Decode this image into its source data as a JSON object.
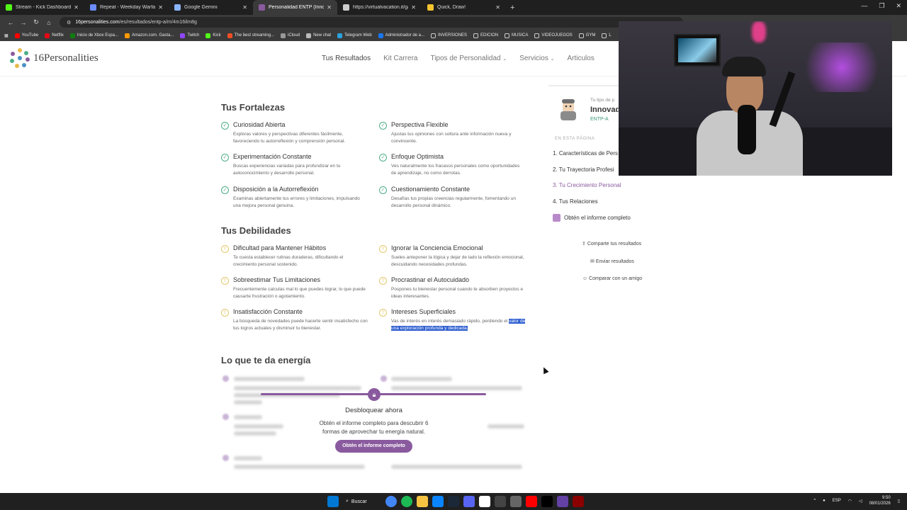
{
  "browser": {
    "tabs": [
      {
        "label": "Stream - Kick Dashboard",
        "color": "#53fc18"
      },
      {
        "label": "Repeat - Weekday Warfare - E",
        "color": "#6b8cff"
      },
      {
        "label": "Google Gemini",
        "color": "#8ab4f8"
      },
      {
        "label": "Personalidad ENTP (Innovador)",
        "color": "#8a5a9e"
      },
      {
        "label": "https://virtualvacation.it/game",
        "color": "#cccccc"
      },
      {
        "label": "Quick, Draw!",
        "color": "#f4c430"
      }
    ],
    "new_tab": "+",
    "url_host": "16personalities.com",
    "url_path": "/es/resultados/entp-a/m/4m16ilm8g",
    "bookmarks": [
      {
        "label": "YouTube",
        "color": "#ff0000"
      },
      {
        "label": "Netflix",
        "color": "#e50914"
      },
      {
        "label": "Inicio de Xbox Espa...",
        "color": "#107c10"
      },
      {
        "label": "Amazon.com. Gasta...",
        "color": "#ff9900"
      },
      {
        "label": "Twitch",
        "color": "#9146ff"
      },
      {
        "label": "Kick",
        "color": "#53fc18"
      },
      {
        "label": "The best streaming...",
        "color": "#f04e23"
      },
      {
        "label": "iCloud",
        "color": "#999999"
      },
      {
        "label": "New chat",
        "color": "#bbbbbb"
      },
      {
        "label": "Telegram Web",
        "color": "#2aa3de"
      },
      {
        "label": "Administrador de a...",
        "color": "#1877f2"
      },
      {
        "label": "INVERSIONES",
        "color": "#cccccc"
      },
      {
        "label": "EDICION",
        "color": "#cccccc"
      },
      {
        "label": "MUSICA",
        "color": "#cccccc"
      },
      {
        "label": "VIDEOJUEGOS",
        "color": "#cccccc"
      },
      {
        "label": "GYM",
        "color": "#cccccc"
      },
      {
        "label": "L",
        "color": "#cccccc"
      }
    ]
  },
  "site": {
    "logo": "16Personalities",
    "nav": [
      "Tus Resultados",
      "Kit Carrera",
      "Tipos de Personalidad",
      "Servicios",
      "Articulos"
    ],
    "strengths_title": "Tus Fortalezas",
    "strengths": [
      {
        "title": "Curiosidad Abierta",
        "desc": "Exploras valores y perspectivas diferentes fácilmente, favoreciendo tu autorreflexión y comprensión personal."
      },
      {
        "title": "Perspectiva Flexible",
        "desc": "Ajustas tus opiniones con soltura ante información nueva y convincente."
      },
      {
        "title": "Experimentación Constante",
        "desc": "Buscas experiencias variadas para profundizar en tu autoconocimiento y desarrollo personal."
      },
      {
        "title": "Enfoque Optimista",
        "desc": "Ves naturalmente los fracasos personales como oportunidades de aprendizaje, no como derrotas."
      },
      {
        "title": "Disposición a la Autorreflexión",
        "desc": "Examinas abiertamente tus errores y limitaciones, impulsando una mejora personal genuina."
      },
      {
        "title": "Cuestionamiento Constante",
        "desc": "Desafías tus propias creencias regularmente, fomentando un desarrollo personal dinámico."
      }
    ],
    "weaknesses_title": "Tus Debilidades",
    "weaknesses": [
      {
        "title": "Dificultad para Mantener Hábitos",
        "desc": "Te cuesta establecer rutinas duraderas, dificultando el crecimiento personal sostenido."
      },
      {
        "title": "Ignorar la Conciencia Emocional",
        "desc": "Sueles anteponer la lógica y dejar de lado la reflexión emocional, descuidando necesidades profundas."
      },
      {
        "title": "Sobreestimar Tus Limitaciones",
        "desc": "Frecuentemente calculas mal lo que puedes lograr, lo que puede causarte frustración o agotamiento."
      },
      {
        "title": "Procrastinar el Autocuidado",
        "desc": "Pospones tu bienestar personal cuando te absorben proyectos e ideas interesantes."
      },
      {
        "title": "Insatisfacción Constante",
        "desc": "La búsqueda de novedades puede hacerte sentir insatisfecho con tus logros actuales y disminuir tu bienestar."
      },
      {
        "title": "Intereses Superficiales",
        "desc_plain": "Vas de interés en interés demasiado rápido, perdiendo el",
        "desc_selected": "valor de una exploración profunda y dedicada."
      }
    ],
    "energy_title": "Lo que te da energía",
    "unlock_title": "Desbloquear ahora",
    "unlock_desc": "Obtén el informe completo para descubrir 6 formas de aprovechar tu energía natural.",
    "unlock_button": "Obtén el informe completo"
  },
  "sidebar": {
    "type_label": "Tu tipo de p",
    "type_name": "Innovad",
    "type_code": "ENTP-A",
    "on_page": "EN ESTA PÁGINA",
    "toc": [
      "1. Características de Pers",
      "2. Tu Trayectoria Profesi",
      "3. Tu Crecimiento Personal",
      "4. Tus Relaciones"
    ],
    "report": "Obtén el informe completo",
    "share": "Comparte tus resultados",
    "email": "Enviar resultados",
    "compare": "Comparar con un amigo"
  },
  "taskbar": {
    "search": "Buscar",
    "lang": "ESP",
    "time": "9:50",
    "date": "08/01/2026",
    "icons": [
      "#0078d4",
      "#4285f4",
      "#1db954",
      "#f5c242",
      "#0a84ff",
      "#1b2838",
      "#5865f2",
      "#ffffff",
      "#444444",
      "#ff0000",
      "#000000",
      "#6441a5",
      "#8b0000"
    ]
  }
}
